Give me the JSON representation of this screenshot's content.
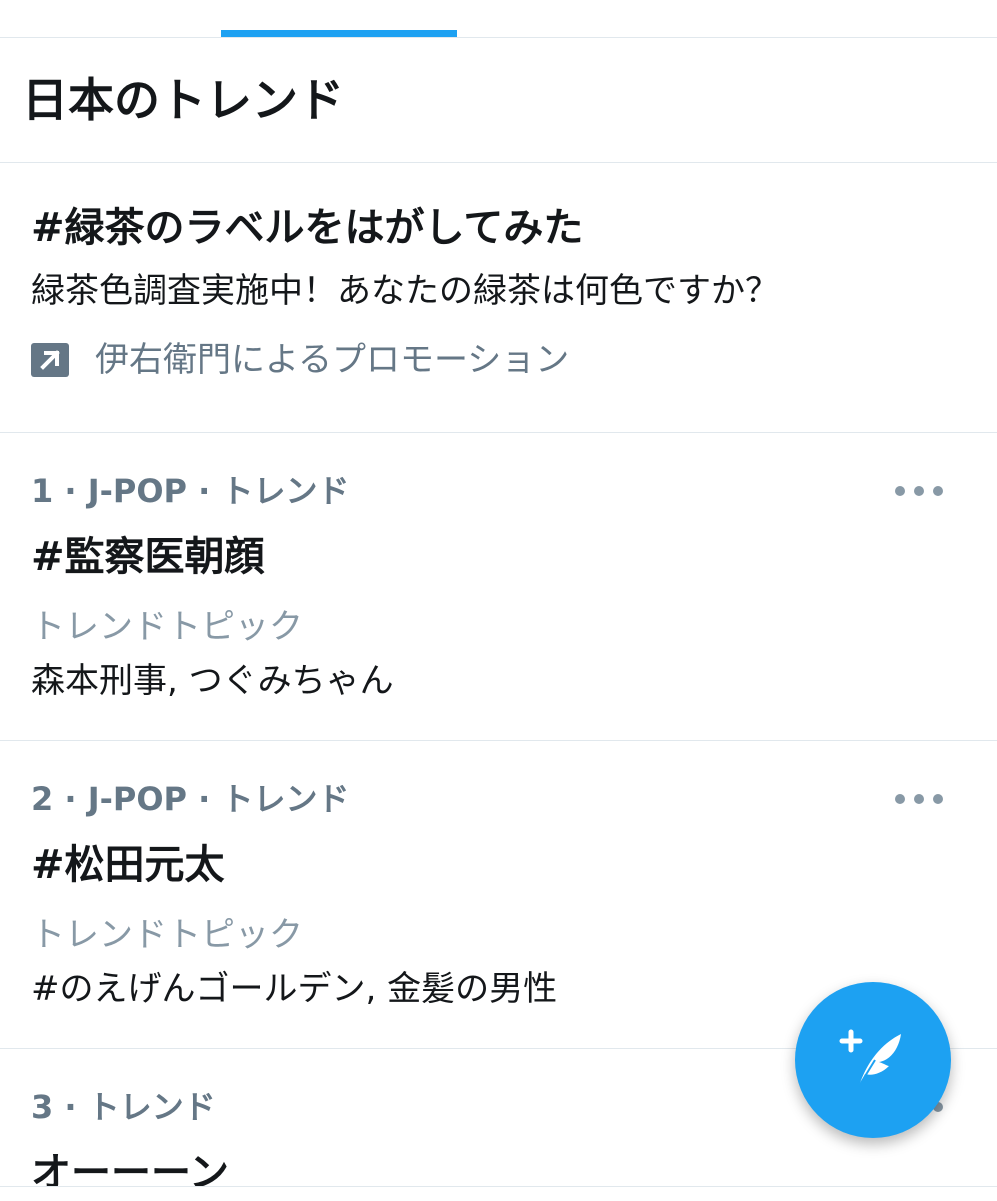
{
  "tabs": {
    "active_indicator_color": "#1da1f2"
  },
  "section": {
    "title": "日本のトレンド"
  },
  "promoted": {
    "title": "#緑茶のラベルをはがしてみた",
    "description": "緑茶色調査実施中！あなたの緑茶は何色ですか？",
    "promoted_by": "伊右衛門によるプロモーション",
    "icon": "promoted-arrow-icon"
  },
  "trends": [
    {
      "meta": "1 · J-POP · トレンド",
      "name": "#監察医朝顔",
      "topic_label": "トレンドトピック",
      "topic_value": "森本刑事, つぐみちゃん"
    },
    {
      "meta": "2 · J-POP · トレンド",
      "name": "#松田元太",
      "topic_label": "トレンドトピック",
      "topic_value": "#のえげんゴールデン, 金髪の男性"
    },
    {
      "meta": "3 · トレンド",
      "name": "オーーーン"
    }
  ],
  "fab": {
    "icon": "compose-tweet-icon",
    "color": "#1da1f2"
  },
  "colors": {
    "accent": "#1da1f2",
    "secondary_text": "#657786",
    "divider": "#e1e8ed"
  }
}
